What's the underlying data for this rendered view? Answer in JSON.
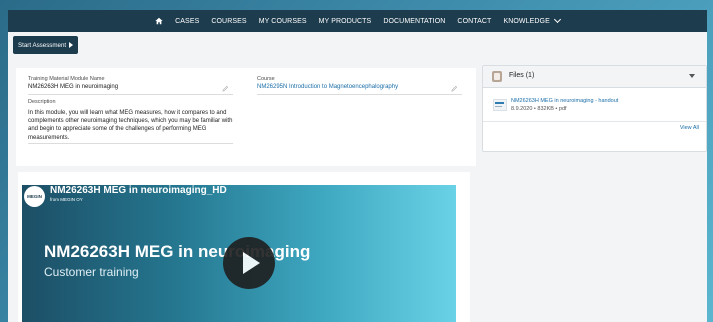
{
  "nav": {
    "items": [
      "CASES",
      "COURSES",
      "MY COURSES",
      "MY PRODUCTS",
      "DOCUMENTATION",
      "CONTACT",
      "KNOWLEDGE"
    ]
  },
  "actions": {
    "start_assessment": "Start Assessment"
  },
  "record": {
    "module_name_label": "Training Material Module Name",
    "module_name_value": "NM26263H MEG in neuroimaging",
    "course_label": "Course",
    "course_value": "NM26295N Introduction to Magnetoencephalography",
    "description_label": "Description",
    "description_value": "In this module, you will learn what MEG measures, how it compares to and complements other neuroimaging techniques, which you may be familiar with and begin to appreciate some of the challenges of performing MEG measurements."
  },
  "files": {
    "title": "Files (1)",
    "file_name": "NM26263H MEG in neuroimaging - handout",
    "file_meta": "8.9.2020 • 832KB • pdf",
    "view_all": "View All"
  },
  "video": {
    "logo_text": "MEGIN",
    "title": "NM26263H MEG in neuroimaging_HD",
    "from": "from MEGIN OY",
    "main_title": "NM26263H MEG in neuroimaging",
    "subtitle": "Customer training"
  },
  "colors": {
    "navbar": "#1d3c4e",
    "link": "#1b6ea8",
    "background_gradient_start": "#2a6b88",
    "background_gradient_end": "#5ab6cf"
  }
}
